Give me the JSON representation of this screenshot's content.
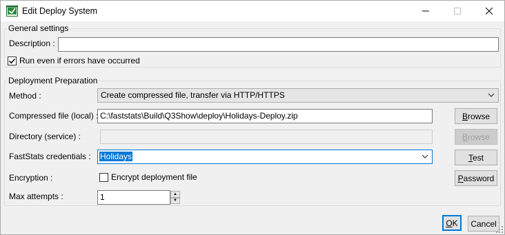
{
  "window": {
    "title": "Edit Deploy System"
  },
  "general": {
    "legend": "General settings",
    "description_label": "Description :",
    "description_value": "",
    "run_errors_label": "Run even if errors have occurred",
    "run_errors_checked": true
  },
  "deployment": {
    "legend": "Deployment Preparation",
    "method_label": "Method :",
    "method_value": "Create compressed file, transfer via HTTP/HTTPS",
    "compressed_label": "Compressed file (local) :",
    "compressed_value": "C:\\faststats\\Build\\Q3Show\\deploy\\Holidays-Deploy.zip",
    "directory_label": "Directory (service) :",
    "directory_value": "",
    "credentials_label": "FastStats credentials :",
    "credentials_value": "Holidays",
    "encryption_label": "Encryption :",
    "encrypt_label": "Encrypt deployment file",
    "encrypt_checked": false,
    "max_attempts_label": "Max attempts :",
    "max_attempts_value": "1"
  },
  "buttons": {
    "browse_1": {
      "underlined": "B",
      "rest": "rowse"
    },
    "browse_2": {
      "underlined": "B",
      "rest": "rowse"
    },
    "test": {
      "underlined": "T",
      "rest": "est"
    },
    "password": {
      "underlined": "P",
      "rest": "assword"
    },
    "ok": {
      "underlined": "O",
      "rest": "K"
    },
    "cancel": "Cancel"
  },
  "icons": {
    "app": "deploy-app-icon",
    "minimize": "minimize-icon",
    "maximize": "maximize-icon",
    "close": "close-icon"
  }
}
